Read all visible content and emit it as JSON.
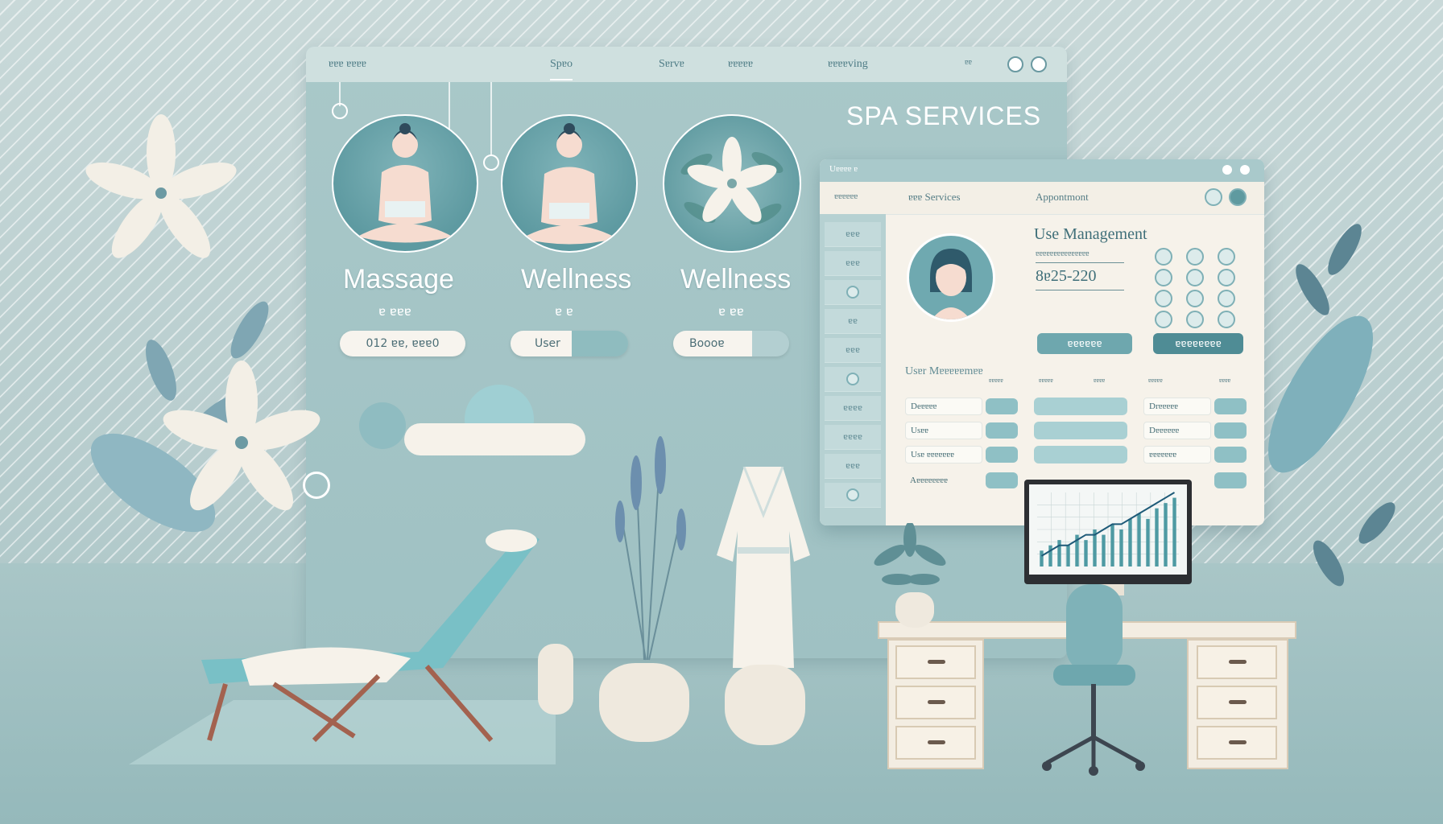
{
  "main_window": {
    "nav": {
      "brand": "ɐɐɐ ɐɐɐɐ",
      "tabs": [
        "Spɐo",
        "Sɐrvɐ",
        "ɐɐɐɐɐ",
        "ɐɐɐɐving"
      ],
      "small": "ɐɐ"
    },
    "title": "SPA SERVICES",
    "services": [
      {
        "label": "Massage",
        "sub": "ɐ ɐɐɐ",
        "pill": "012 ɐɐ, ɐɐɐ0"
      },
      {
        "label": "Wellness",
        "sub": "ɐ ɐ",
        "pill": "User"
      },
      {
        "label": "Wellness",
        "sub": "ɐ ɐɐ",
        "pill": "Boooɐ"
      }
    ]
  },
  "mgmt_window": {
    "title": "Uɐɐɐɐ ɐ",
    "top_tabs": [
      "ɐɐɐɐɐɐ",
      "ɐɐɐ Services",
      "Appontmont"
    ],
    "side_items": [
      "ɐɐɐ",
      "ɐɐɐ",
      "",
      "ɐɐ",
      "ɐɐɐ",
      "",
      "ɐɐɐɐ",
      "ɐɐɐɐ",
      "ɐɐɐ",
      ""
    ],
    "heading": "Use Management",
    "field_label": "ɐɐɐɐɐɐɐɐɐɐɐɐɐɐɐ",
    "field_value": "8ɐ25-220",
    "buttons": [
      "ɐɐɐɐɐɐ",
      "ɐɐɐɐɐɐɐɐ"
    ],
    "section_title": "Usɐr Mɐɐɐɐɐmɐɐ",
    "table_headers": [
      "ɐɐɐɐɐ",
      "ɐɐɐɐɐ",
      "ɐɐɐɐ",
      "ɐɐɐɐɐ",
      "ɐɐɐɐ"
    ],
    "rows": [
      {
        "name": "Deɐɐɐɐ",
        "right": "Drɐɐɐɐɐ"
      },
      {
        "name": "Usɐɐ",
        "right": "Dɐɐɐɐɐɐ"
      },
      {
        "name": "Usɐ ɐɐɐɐɐɐɐ",
        "right": "ɐɐɐɐɐɐɐ"
      },
      {
        "name": "Aɐɐɐɐɐɐɐɐ",
        "right": ""
      }
    ]
  },
  "chart_data": {
    "type": "bar",
    "values": [
      3,
      4,
      5,
      4,
      6,
      5,
      7,
      6,
      8,
      7,
      9,
      10,
      9,
      11,
      12,
      13
    ],
    "line": [
      2,
      3,
      4,
      4,
      5,
      6,
      6,
      7,
      8,
      8,
      9,
      10,
      11,
      12,
      13,
      14
    ]
  },
  "colors": {
    "accent": "#6ea7ae",
    "background": "#b9cfd0",
    "panel": "#f6f2ea"
  }
}
